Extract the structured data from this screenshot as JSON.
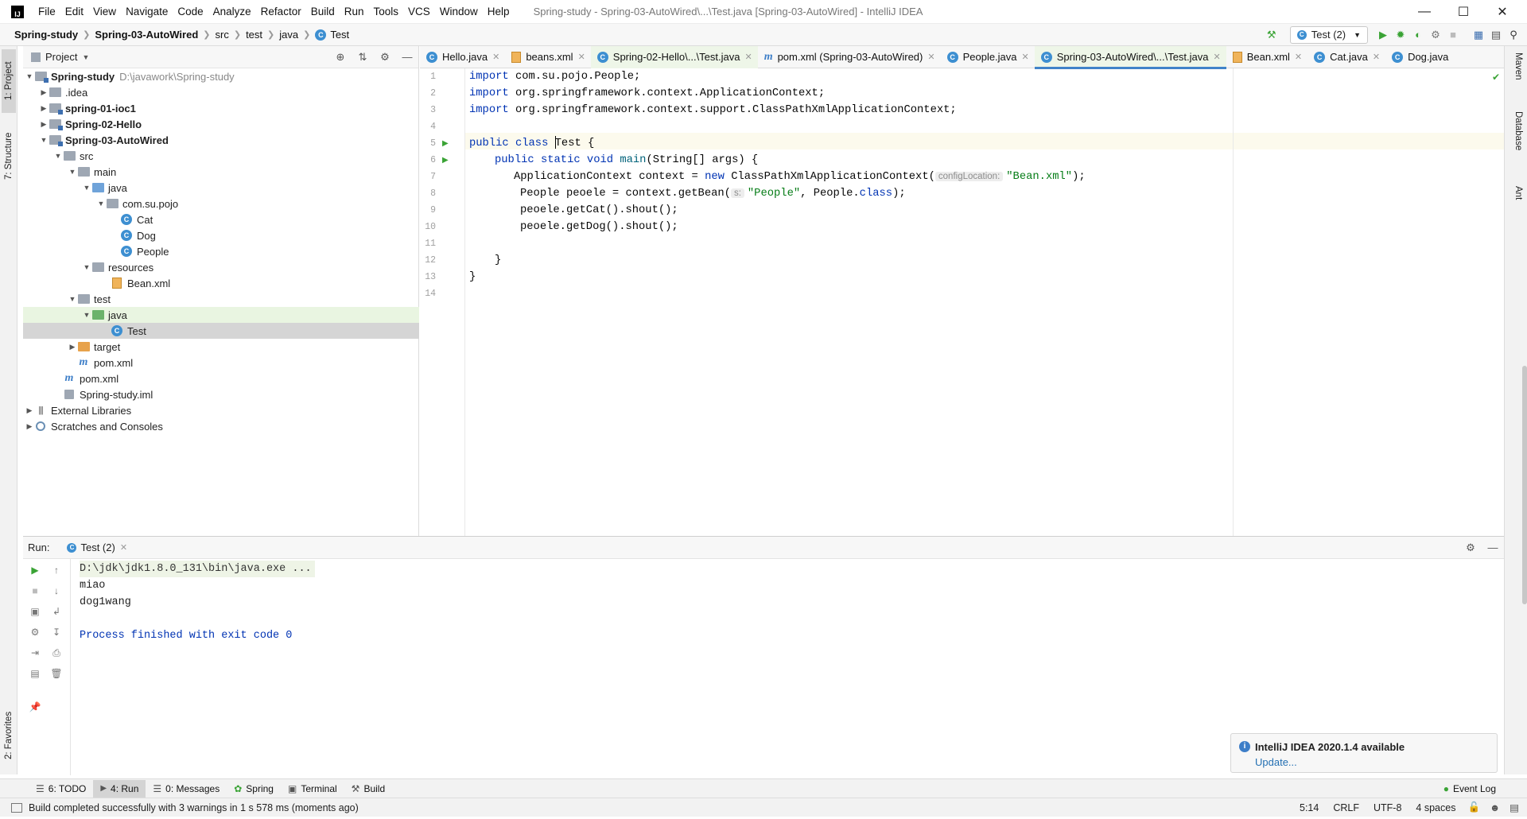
{
  "menu": {
    "items": [
      "File",
      "Edit",
      "View",
      "Navigate",
      "Code",
      "Analyze",
      "Refactor",
      "Build",
      "Run",
      "Tools",
      "VCS",
      "Window",
      "Help"
    ],
    "window_title": "Spring-study - Spring-03-AutoWired\\...\\Test.java [Spring-03-AutoWired] - IntelliJ IDEA",
    "logo_text": "IJ"
  },
  "breadcrumb": [
    "Spring-study",
    "Spring-03-AutoWired",
    "src",
    "test",
    "java",
    "Test"
  ],
  "run_config": "Test (2)",
  "project_panel": {
    "title": "Project",
    "tree": [
      {
        "label": "Spring-study",
        "extra": "D:\\javawork\\Spring-study",
        "bold": true
      },
      {
        "label": ".idea"
      },
      {
        "label": "spring-01-ioc1",
        "bold": true
      },
      {
        "label": "Spring-02-Hello",
        "bold": true
      },
      {
        "label": "Spring-03-AutoWired",
        "bold": true
      },
      {
        "label": "src"
      },
      {
        "label": "main"
      },
      {
        "label": "java"
      },
      {
        "label": "com.su.pojo"
      },
      {
        "label": "Cat"
      },
      {
        "label": "Dog"
      },
      {
        "label": "People"
      },
      {
        "label": "resources"
      },
      {
        "label": "Bean.xml"
      },
      {
        "label": "test"
      },
      {
        "label": "java"
      },
      {
        "label": "Test"
      },
      {
        "label": "target"
      },
      {
        "label": "pom.xml"
      },
      {
        "label": "pom.xml"
      },
      {
        "label": "Spring-study.iml"
      },
      {
        "label": "External Libraries"
      },
      {
        "label": "Scratches and Consoles"
      }
    ]
  },
  "tabs": [
    "Hello.java",
    "beans.xml",
    "Spring-02-Hello\\...\\Test.java",
    "pom.xml (Spring-03-AutoWired)",
    "People.java",
    "Spring-03-AutoWired\\...\\Test.java",
    "Bean.xml",
    "Cat.java",
    "Dog.java"
  ],
  "editor": {
    "line_numbers": [
      "1",
      "2",
      "3",
      "4",
      "5",
      "6",
      "7",
      "8",
      "9",
      "10",
      "11",
      "12",
      "13",
      "14"
    ],
    "l1_kw": "import",
    "l1_rest": " com.su.pojo.People;",
    "l2_kw": "import",
    "l2_rest": " org.springframework.context.ApplicationContext;",
    "l3_kw": "import",
    "l3_rest": " org.springframework.context.support.ClassPathXmlApplicationContext;",
    "l5_kw": "public class ",
    "l5_cls_a": "T",
    "l5_cls_b": "est",
    "l5_rest": " {",
    "l6_kw": "public static void ",
    "l6_fn": "main",
    "l6_rest": "(String[] args) {",
    "l7_a": "ApplicationContext context = ",
    "l7_kw": "new",
    "l7_b": " ClassPathXmlApplicationContext(",
    "l7_hint": "configLocation:",
    "l7_str": "\"Bean.xml\"",
    "l7_c": ");",
    "l8_a": "People peoele = context.getBean(",
    "l8_hint": "s:",
    "l8_str": "\"People\"",
    "l8_b": ", People.",
    "l8_kw": "class",
    "l8_c": ");",
    "l9": "peoele.getCat().shout();",
    "l10": "peoele.getDog().shout();",
    "l12": "}",
    "l13": "}"
  },
  "run_panel": {
    "label": "Run:",
    "tab": "Test (2)",
    "console": [
      "D:\\jdk\\jdk1.8.0_131\\bin\\java.exe ...",
      "miao",
      "dog1wang",
      "",
      "Process finished with exit code 0"
    ]
  },
  "left_strip": {
    "project": "1: Project",
    "structure": "7: Structure",
    "favorites": "2: Favorites"
  },
  "right_strip": {
    "maven": "Maven",
    "database": "Database",
    "ant": "Ant"
  },
  "bottom_tabs": [
    "6: TODO",
    "4: Run",
    "0: Messages",
    "Spring",
    "Terminal",
    "Build"
  ],
  "event_log": "Event Log",
  "notification": {
    "title": "IntelliJ IDEA 2020.1.4 available",
    "link": "Update..."
  },
  "status": {
    "message": "Build completed successfully with 3 warnings in 1 s 578 ms (moments ago)",
    "position": "5:14",
    "line_sep": "CRLF",
    "encoding": "UTF-8",
    "indent": "4 spaces"
  },
  "colors": {
    "keyword": "#0033b3",
    "string": "#067d17",
    "accent": "#4083c9",
    "run_green": "#3aa335"
  }
}
